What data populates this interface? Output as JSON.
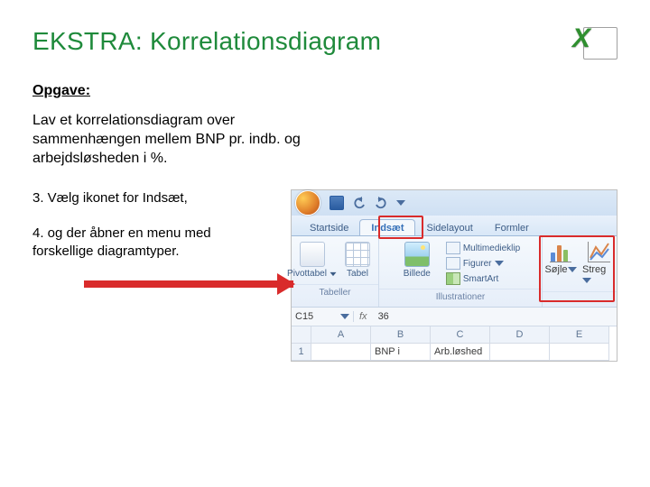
{
  "title": "EKSTRA: Korrelationsdiagram",
  "sub_heading": "Opgave:",
  "task_text": "Lav et korrelationsdiagram over sammenhængen mellem BNP pr. indb. og arbejdsløsheden i %.",
  "step3": "3. Vælg ikonet for Indsæt,",
  "step4": "4. og der åbner en menu med forskellige diagramtyper.",
  "ribbon": {
    "tabs": [
      "Startside",
      "Indsæt",
      "Sidelayout",
      "Formler"
    ],
    "selected_tab_index": 1,
    "groups": {
      "tables": {
        "label": "Tabeller",
        "buttons": [
          "Pivottabel",
          "Tabel"
        ]
      },
      "illustrations": {
        "label": "Illustrationer",
        "big": "Billede",
        "mini": [
          "Multimedieklip",
          "Figurer",
          "SmartArt"
        ]
      },
      "charts": {
        "buttons": [
          "Søjle",
          "Streg"
        ]
      }
    }
  },
  "sheet": {
    "namebox": "C15",
    "fx": "fx",
    "formula_value": "36",
    "columns": [
      "A",
      "B",
      "C",
      "D",
      "E"
    ],
    "row_hdr": "1",
    "b1": "BNP i",
    "c1": "Arb.løshed"
  }
}
